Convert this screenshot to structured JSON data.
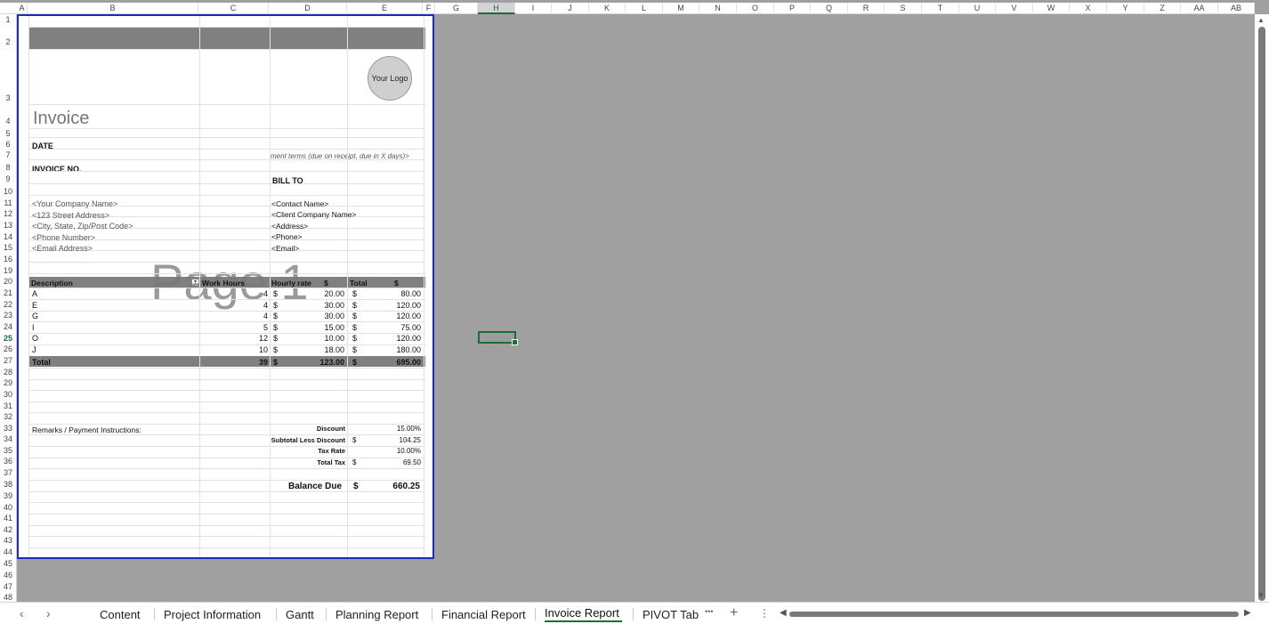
{
  "columns": [
    "A",
    "B",
    "C",
    "D",
    "E",
    "F",
    "G",
    "H",
    "I",
    "J",
    "K",
    "L",
    "M",
    "N",
    "O",
    "P",
    "Q",
    "R",
    "S",
    "T",
    "U",
    "V",
    "W",
    "X",
    "Y",
    "Z",
    "AA",
    "AB"
  ],
  "rows": [
    "1",
    "2",
    "3",
    "4",
    "5",
    "6",
    "7",
    "8",
    "9",
    "10",
    "11",
    "12",
    "13",
    "14",
    "15",
    "16",
    "19",
    "20",
    "21",
    "22",
    "23",
    "24",
    "25",
    "26",
    "27",
    "28",
    "29",
    "30",
    "31",
    "32",
    "33",
    "34",
    "35",
    "36",
    "37",
    "38",
    "39",
    "40",
    "41",
    "42",
    "43",
    "44",
    "45",
    "46",
    "47",
    "48"
  ],
  "selected_column": "H",
  "selected_row": "25",
  "invoice": {
    "logo": "Your Logo",
    "title": "Invoice",
    "date_label": "DATE",
    "payment_terms": "ment terms (due on receipt, due in X days)>",
    "invoice_no_label": "INVOICE NO.",
    "bill_to_label": "BILL TO",
    "company": [
      "<Your Company Name>",
      "<123 Street Address>",
      "<City, State, Zip/Post Code>",
      "<Phone Number>",
      "<Email Address>"
    ],
    "client": [
      "<Contact Name>",
      "<Client Company Name>",
      "<Address>",
      "<Phone>",
      "<Email>"
    ],
    "watermark": "Page 1",
    "table": {
      "headers": [
        "Description",
        "Work Hours",
        "Hourly rate",
        "$",
        "Total",
        "$"
      ],
      "rows": [
        {
          "desc": "A",
          "hours": "4",
          "cur1": "$",
          "rate": "20.00",
          "cur2": "$",
          "total": "80.00"
        },
        {
          "desc": "E",
          "hours": "4",
          "cur1": "$",
          "rate": "30.00",
          "cur2": "$",
          "total": "120.00"
        },
        {
          "desc": "G",
          "hours": "4",
          "cur1": "$",
          "rate": "30.00",
          "cur2": "$",
          "total": "120.00"
        },
        {
          "desc": "I",
          "hours": "5",
          "cur1": "$",
          "rate": "15.00",
          "cur2": "$",
          "total": "75.00"
        },
        {
          "desc": "O",
          "hours": "12",
          "cur1": "$",
          "rate": "10.00",
          "cur2": "$",
          "total": "120.00"
        },
        {
          "desc": "J",
          "hours": "10",
          "cur1": "$",
          "rate": "18.00",
          "cur2": "$",
          "total": "180.00"
        }
      ],
      "total_row": {
        "desc": "Total",
        "hours": "39",
        "cur1": "$",
        "rate": "123.00",
        "cur2": "$",
        "total": "695.00"
      }
    },
    "remarks_label": "Remarks / Payment Instructions:",
    "summary": [
      {
        "label": "Discount",
        "cur": "",
        "value": "15.00%"
      },
      {
        "label": "Subtotal Less Discount",
        "cur": "$",
        "value": "104.25"
      },
      {
        "label": "Tax Rate",
        "cur": "",
        "value": "10.00%"
      },
      {
        "label": "Total Tax",
        "cur": "$",
        "value": "69.50"
      }
    ],
    "balance_due_label": "Balance Due",
    "balance_due_cur": "$",
    "balance_due_value": "660.25"
  },
  "sheet_tabs": [
    "Content",
    "Project Information",
    "Gantt",
    "Planning Report",
    "Financial Report",
    "Invoice Report",
    "PIVOT Tab"
  ],
  "active_tab": "Invoice Report",
  "tab_controls": {
    "prev": "‹",
    "next": "›",
    "more": "•••",
    "add": "+",
    "menu": "⋮"
  }
}
